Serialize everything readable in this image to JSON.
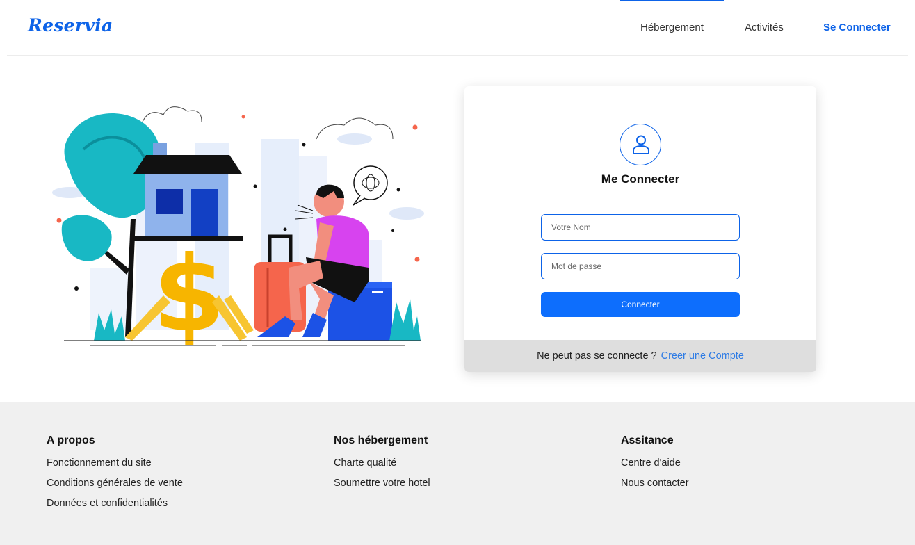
{
  "header": {
    "logo": "Reservia",
    "nav": {
      "hebergement": "Hébergement",
      "activites": "Activités",
      "login": "Se Connecter"
    }
  },
  "login_card": {
    "icon": "user-icon",
    "title": "Me Connecter",
    "name_placeholder": "Votre Nom",
    "password_placeholder": "Mot de passe",
    "submit_label": "Connecter",
    "footer_text": "Ne peut pas se connecte ?",
    "signup_link": "Creer une Compte"
  },
  "footer": {
    "columns": [
      {
        "heading": "A propos",
        "links": [
          "Fonctionnement du site",
          "Conditions générales de vente",
          "Données et confidentialités"
        ]
      },
      {
        "heading": "Nos hébergement",
        "links": [
          "Charte qualité",
          "Soumettre votre hotel"
        ]
      },
      {
        "heading": "Assitance",
        "links": [
          "Centre d'aide",
          "Nous contacter"
        ]
      }
    ]
  },
  "colors": {
    "accent": "#0d63e8",
    "button": "#0d6efd",
    "footer_bg": "#f0f0f0",
    "card_footer_bg": "#dedede"
  }
}
